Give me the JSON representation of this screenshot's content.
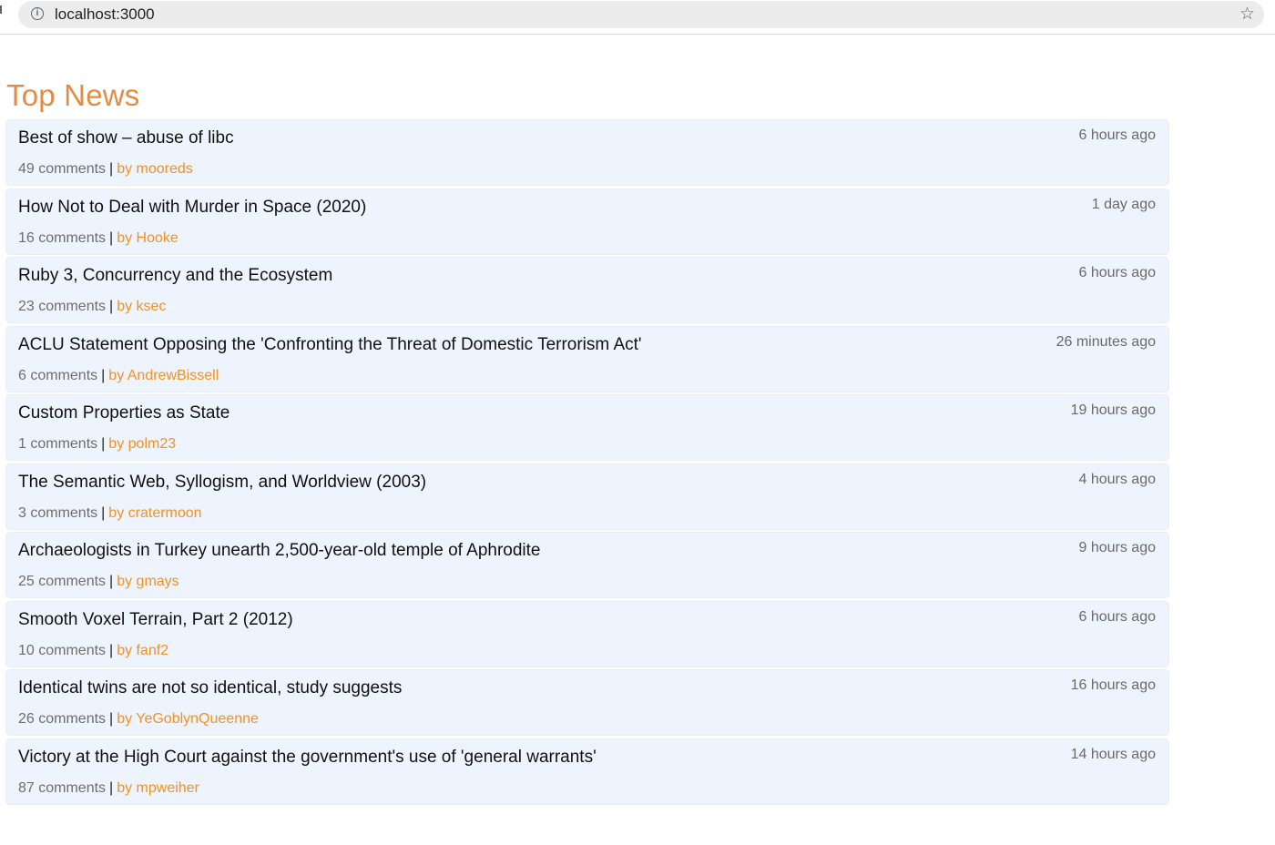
{
  "browser": {
    "url": "localhost:3000",
    "info_icon": "info-icon",
    "bookmark_icon": "star-icon"
  },
  "page": {
    "title": "Top News",
    "title_color": "#e28d46",
    "author_color": "#f29124",
    "item_background": "#eef4fd"
  },
  "stories": [
    {
      "title": "Best of show – abuse of libc",
      "time": "6 hours ago",
      "comments": "49 comments",
      "separator": "|",
      "author": "by mooreds"
    },
    {
      "title": "How Not to Deal with Murder in Space (2020)",
      "time": "1 day ago",
      "comments": "16 comments",
      "separator": "|",
      "author": "by Hooke"
    },
    {
      "title": "Ruby 3, Concurrency and the Ecosystem",
      "time": "6 hours ago",
      "comments": "23 comments",
      "separator": "|",
      "author": "by ksec"
    },
    {
      "title": "ACLU Statement Opposing the 'Confronting the Threat of Domestic Terrorism Act'",
      "time": "26 minutes ago",
      "comments": "6 comments",
      "separator": "|",
      "author": "by AndrewBissell"
    },
    {
      "title": "Custom Properties as State",
      "time": "19 hours ago",
      "comments": "1 comments",
      "separator": "|",
      "author": "by polm23"
    },
    {
      "title": "The Semantic Web, Syllogism, and Worldview (2003)",
      "time": "4 hours ago",
      "comments": "3 comments",
      "separator": "|",
      "author": "by cratermoon"
    },
    {
      "title": "Archaeologists in Turkey unearth 2,500-year-old temple of Aphrodite",
      "time": "9 hours ago",
      "comments": "25 comments",
      "separator": "|",
      "author": "by gmays"
    },
    {
      "title": "Smooth Voxel Terrain, Part 2 (2012)",
      "time": "6 hours ago",
      "comments": "10 comments",
      "separator": "|",
      "author": "by fanf2"
    },
    {
      "title": "Identical twins are not so identical, study suggests",
      "time": "16 hours ago",
      "comments": "26 comments",
      "separator": "|",
      "author": "by YeGoblynQueenne"
    },
    {
      "title": "Victory at the High Court against the government's use of 'general warrants'",
      "time": "14 hours ago",
      "comments": "87 comments",
      "separator": "|",
      "author": "by mpweiher"
    }
  ]
}
